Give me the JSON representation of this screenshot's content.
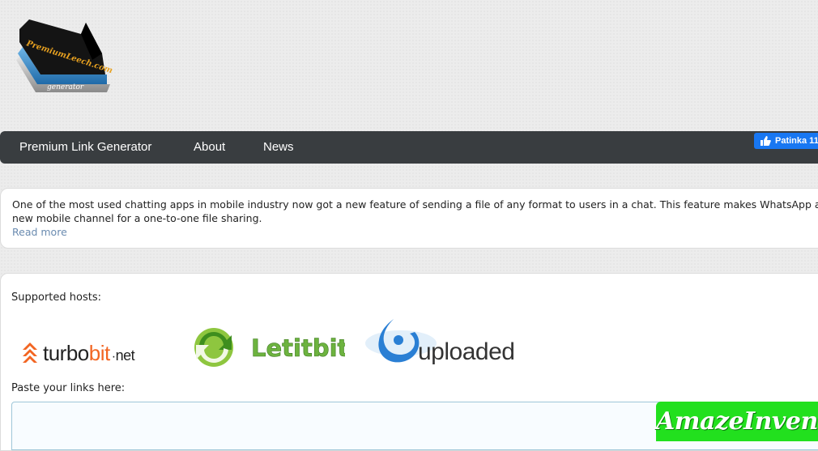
{
  "logo": {
    "line1": "PremiumLeech.com",
    "line2": "generator"
  },
  "nav": {
    "items": [
      {
        "label": "Premium Link Generator"
      },
      {
        "label": "About"
      },
      {
        "label": "News"
      }
    ],
    "fb_like_label": "Patinka 11"
  },
  "news": {
    "text": "One of the most used chatting apps in mobile industry now got a new feature of sending a file of any format to users in a chat. This feature makes WhatsApp a new mobile channel for a one-to-one file sharing.",
    "read_more": "Read more"
  },
  "hosts": {
    "label": "Supported hosts:",
    "logos": {
      "turbobit": {
        "part1": "turbo",
        "part2": "bit",
        "part3": "net"
      },
      "letitbit": "Letitbit",
      "uploaded": "uploaded"
    }
  },
  "paste": {
    "label": "Paste your links here:",
    "value": ""
  },
  "watermark": {
    "text": "AmazeInvent"
  },
  "colors": {
    "navbar": "#393d40",
    "link": "#6a8bb0",
    "facebook": "#1877f2",
    "watermark": "#22e01e",
    "turbobit_orange": "#f26522",
    "letitbit_green": "#6db33f",
    "uploaded_blue": "#2a7fd4"
  }
}
